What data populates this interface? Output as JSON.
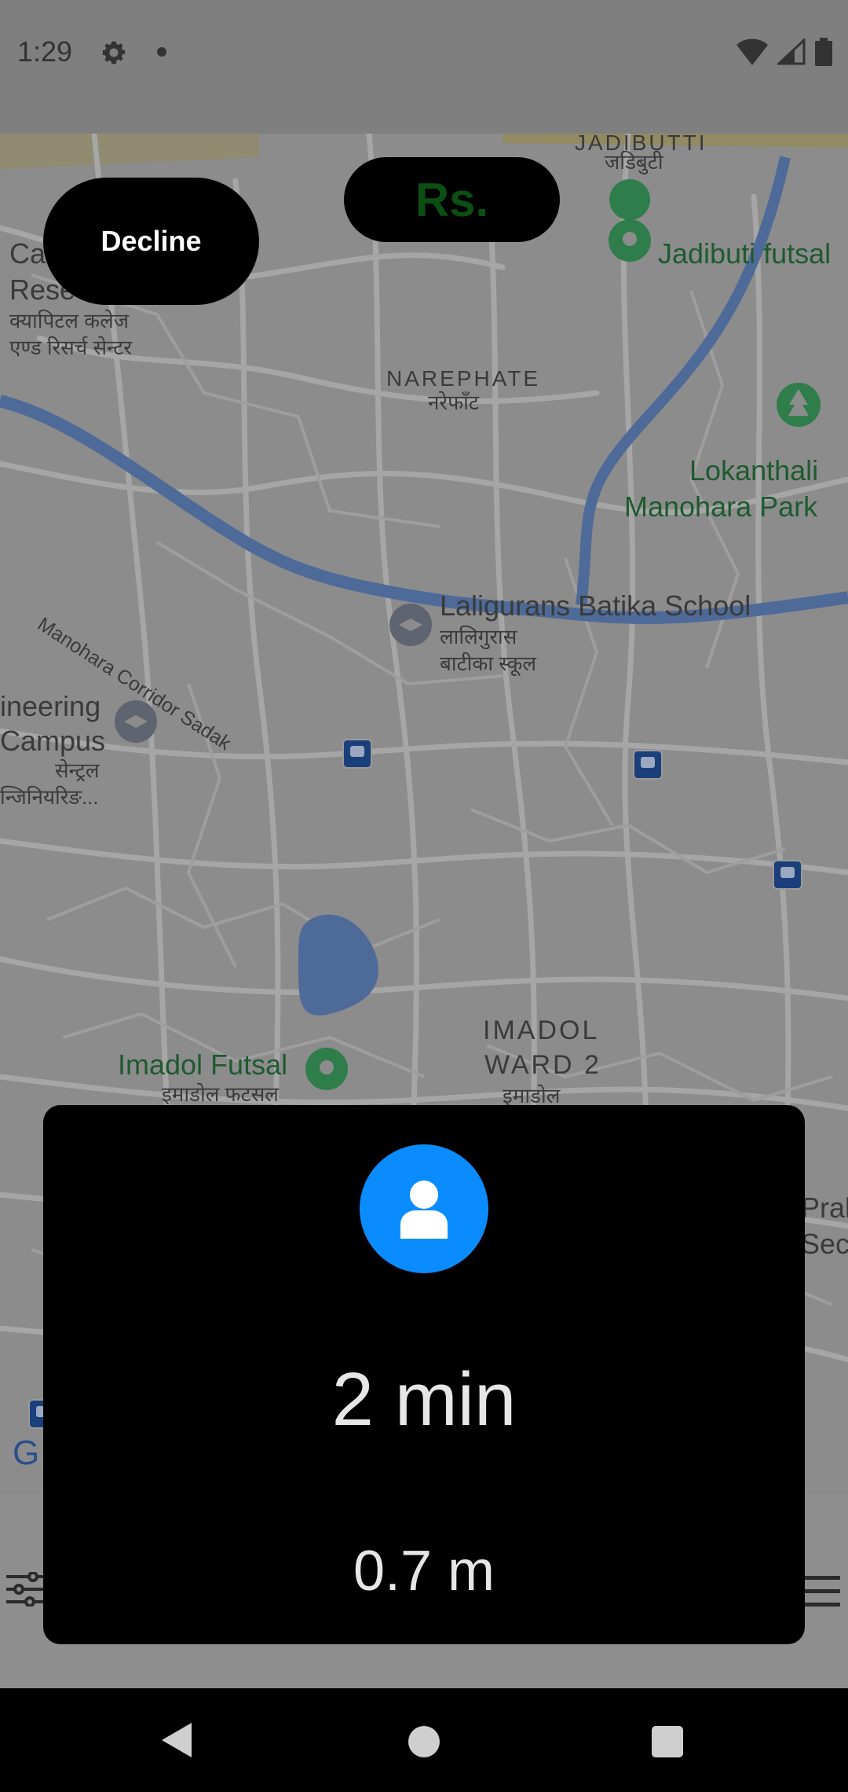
{
  "status_bar": {
    "time": "1:29"
  },
  "map": {
    "labels": {
      "jadibutti": "JADIBUTTI",
      "jadibutti_dev": "जडिबुटी",
      "jadibuti_futsal": "Jadibuti futsal",
      "narephate": "NAREPHATE",
      "narephate_dev": "नरेफाँट",
      "lokanthali_1": "Lokanthali",
      "lokanthali_2": "Manohara Park",
      "capital_1": "Ca",
      "capital_2": "Rese",
      "capital_dev_1": "क्यापिटल कलेज",
      "capital_dev_2": "एण्ड रिसर्च सेन्टर",
      "corridor": "Manohara Corridor Sadak",
      "laligurans": "Laligurans Batika School",
      "laligurans_dev_1": "लालिगुरास",
      "laligurans_dev_2": "बाटीका स्कूल",
      "engineering_1": "ineering",
      "engineering_2": "Campus",
      "engineering_dev_1": "सेन्ट्रल",
      "engineering_dev_2": "न्जिनियरिङ...",
      "imadol_1": "IMADOL",
      "imadol_2": "WARD 2",
      "imadol_dev": "इमाडोल",
      "imadol_futsal": "Imadol Futsal",
      "imadol_futsal_dev": "इमाडोल फटसल",
      "prak_1": "Prak",
      "prak_2": "Sec",
      "google_g": "G"
    }
  },
  "buttons": {
    "decline": "Decline",
    "price": "Rs."
  },
  "card": {
    "eta": "2 min",
    "distance": "0.7 m"
  },
  "colors": {
    "accent": "#0a8cff",
    "price_text": "#0b4f13",
    "green_label": "#1f5a2f"
  }
}
